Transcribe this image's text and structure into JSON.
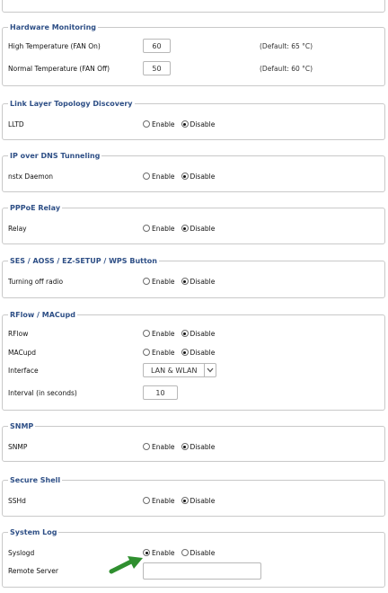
{
  "hardware_monitoring": {
    "title": "Hardware Monitoring",
    "high_temp": {
      "label": "High Temperature (FAN On)",
      "value": "60",
      "hint": "(Default: 65 °C)"
    },
    "normal_temp": {
      "label": "Normal Temperature (FAN Off)",
      "value": "50",
      "hint": "(Default: 60 °C)"
    }
  },
  "lltd": {
    "title": "Link Layer Topology Discovery",
    "row_label": "LLTD",
    "enable": "Enable",
    "disable": "Disable",
    "selected": "Disable"
  },
  "ip_over_dns": {
    "title": "IP over DNS Tunneling",
    "row_label": "nstx Daemon",
    "enable": "Enable",
    "disable": "Disable",
    "selected": "Disable"
  },
  "pppoe_relay": {
    "title": "PPPoE Relay",
    "row_label": "Relay",
    "enable": "Enable",
    "disable": "Disable",
    "selected": "Disable"
  },
  "ses": {
    "title": "SES / AOSS / EZ-SETUP / WPS Button",
    "row_label": "Turning off radio",
    "enable": "Enable",
    "disable": "Disable",
    "selected": "Disable"
  },
  "rflow": {
    "title": "RFlow / MACupd",
    "rflow_label": "RFlow",
    "macupd_label": "MACupd",
    "enable": "Enable",
    "disable": "Disable",
    "rflow_selected": "Disable",
    "macupd_selected": "Disable",
    "interface_label": "Interface",
    "interface_value": "LAN & WLAN",
    "interval_label": "Interval (in seconds)",
    "interval_value": "10"
  },
  "snmp": {
    "title": "SNMP",
    "row_label": "SNMP",
    "enable": "Enable",
    "disable": "Disable",
    "selected": "Disable"
  },
  "ssh": {
    "title": "Secure Shell",
    "row_label": "SSHd",
    "enable": "Enable",
    "disable": "Disable",
    "selected": "Disable"
  },
  "syslog": {
    "title": "System Log",
    "syslogd_label": "Syslogd",
    "enable": "Enable",
    "disable": "Disable",
    "selected": "Enable",
    "remote_label": "Remote Server",
    "remote_value": ""
  },
  "colors": {
    "legend": "#2e4f86",
    "arrow": "#2f8f2f"
  }
}
